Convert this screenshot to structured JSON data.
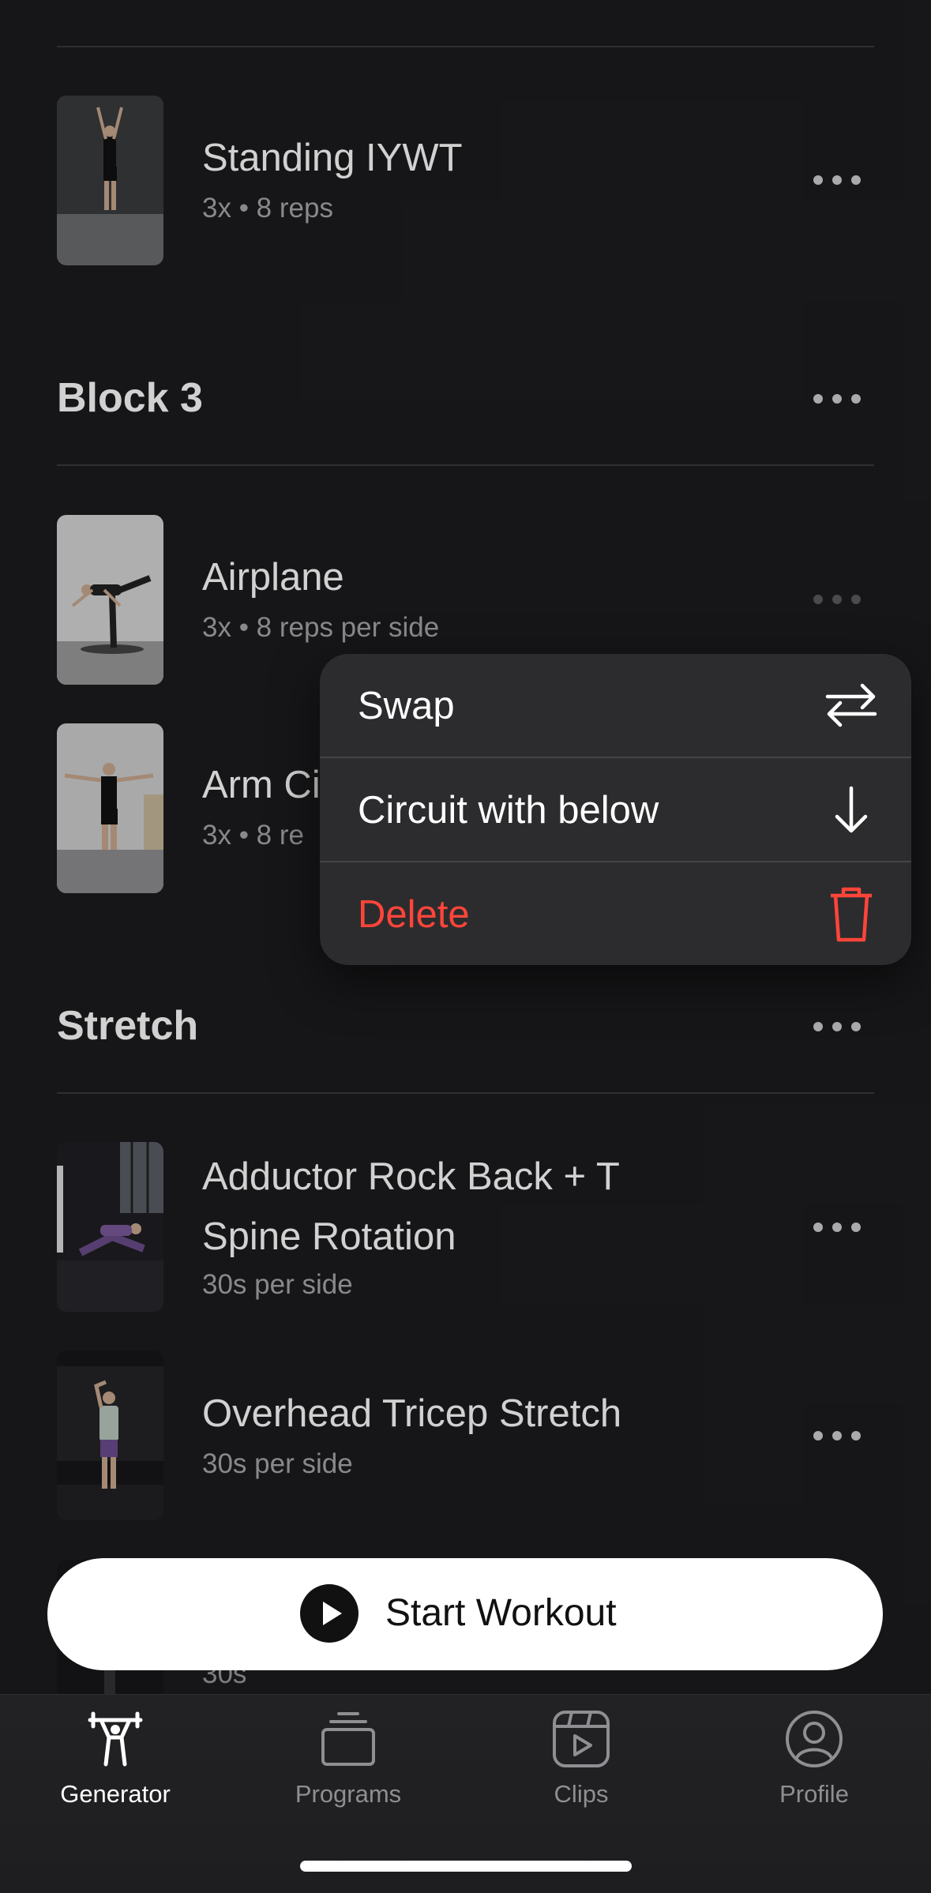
{
  "colors": {
    "background": "#1c1c1e",
    "menu_background": "#2c2c2e",
    "destructive": "#ff453a",
    "tab_inactive": "#8e8e93"
  },
  "exercises_top": [
    {
      "title": "Standing IYWT",
      "subtitle": "3x • 8 reps"
    }
  ],
  "block3": {
    "title": "Block 3",
    "exercises": [
      {
        "title": "Airplane",
        "subtitle": "3x • 8 reps per side"
      },
      {
        "title": "Arm Ci",
        "subtitle": "3x • 8 re"
      }
    ]
  },
  "stretch": {
    "title": "Stretch",
    "exercises": [
      {
        "title_line1": "Adductor Rock Back + T",
        "title_line2": "Spine Rotation",
        "subtitle": "30s per side"
      },
      {
        "title": "Overhead Tricep Stretch",
        "subtitle": "30s per side"
      },
      {
        "subtitle": "30s"
      }
    ]
  },
  "context_menu": {
    "items": [
      {
        "label": "Swap",
        "icon": "swap-arrows-icon"
      },
      {
        "label": "Circuit with below",
        "icon": "arrow-down-icon"
      },
      {
        "label": "Delete",
        "icon": "trash-icon"
      }
    ]
  },
  "start_button": {
    "label": "Start Workout",
    "icon": "play-icon"
  },
  "tabbar": {
    "tabs": [
      {
        "label": "Generator",
        "icon": "weightlifter-icon",
        "active": true
      },
      {
        "label": "Programs",
        "icon": "stack-icon",
        "active": false
      },
      {
        "label": "Clips",
        "icon": "clips-icon",
        "active": false
      },
      {
        "label": "Profile",
        "icon": "person-icon",
        "active": false
      }
    ]
  }
}
